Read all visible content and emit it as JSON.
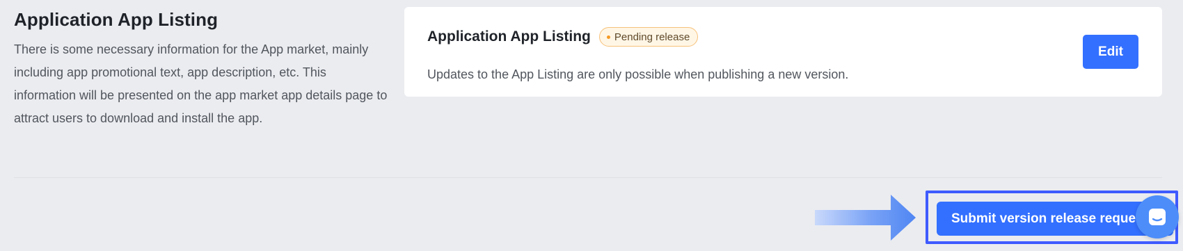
{
  "section": {
    "title": "Application App Listing",
    "description": "There is some necessary information for the App market, mainly including app promotional text, app description, etc. This information will be presented on the app market app details page to attract users to download and install the app."
  },
  "card": {
    "title": "Application App Listing",
    "status": "Pending release",
    "note": "Updates to the App Listing are only possible when publishing a new version.",
    "edit_label": "Edit"
  },
  "footer": {
    "submit_label": "Submit version release request"
  },
  "icons": {
    "arrow": "arrow-right-icon",
    "help": "chat-bubble-icon"
  },
  "colors": {
    "primary": "#3370ff",
    "status_bg": "#fff6e6",
    "status_border": "#f7c27a",
    "status_dot": "#f59a23",
    "highlight": "#3f5bff",
    "page_bg": "#ebecf0"
  }
}
